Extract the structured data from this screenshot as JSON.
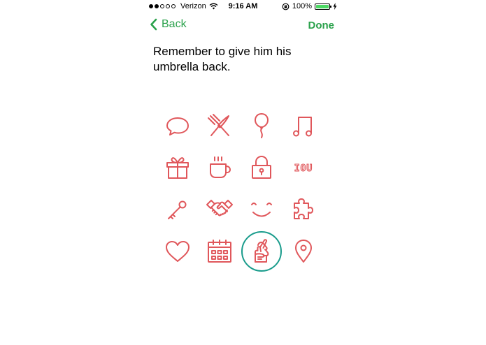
{
  "status_bar": {
    "carrier": "Verizon",
    "time": "9:16 AM",
    "battery_percent": "100%",
    "signal_bars_filled": 2,
    "signal_bars_total": 5
  },
  "nav": {
    "back_label": "Back",
    "done_label": "Done"
  },
  "note": {
    "text": "Remember to give him his umbrella back."
  },
  "colors": {
    "accent_green": "#2aa14b",
    "icon_red": "#e0575b",
    "selection_teal": "#1a9c8c"
  },
  "icon_grid": {
    "iou_text": "IOU",
    "selected_icon": "fingers-crossed-icon",
    "icons": [
      "chat-bubble-icon",
      "fork-knife-icon",
      "balloon-icon",
      "music-note-icon",
      "gift-icon",
      "coffee-mug-icon",
      "lock-icon",
      "iou-icon",
      "key-icon",
      "handshake-icon",
      "smile-icon",
      "puzzle-icon",
      "heart-icon",
      "calendar-icon",
      "fingers-crossed-icon",
      "location-pin-icon"
    ]
  }
}
